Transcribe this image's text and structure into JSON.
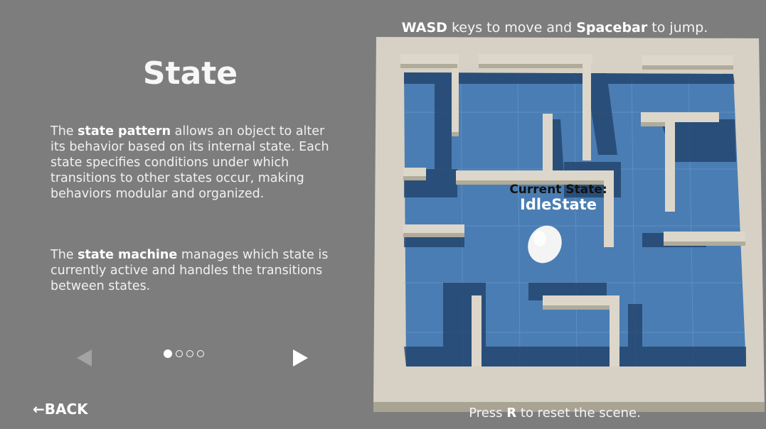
{
  "left_panel": {
    "title": "State",
    "para1": {
      "t1": "The ",
      "b1": "state pattern",
      "t2": " allows an object to alter its behavior based on its internal state. Each state specifies conditions under which transitions to other states occur, making behaviors modular and organized."
    },
    "para2": {
      "t1": "The ",
      "b1": "state machine",
      "t2": " manages which state is currently active and handles the transitions between states."
    },
    "pagination": {
      "current": 1,
      "total": 4
    },
    "back_label": "←BACK"
  },
  "scene": {
    "hint_top": {
      "k1": "WASD",
      "t1": " keys to move and ",
      "k2": "Spacebar",
      "t2": " to jump."
    },
    "hint_bottom": {
      "t1": "Press ",
      "k1": "R",
      "t2": " to reset the scene."
    },
    "state_caption": "Current State:",
    "state_value": "IdleState"
  },
  "colors": {
    "background": "#7d7d7d",
    "floor": "#4a7db3",
    "wall_top": "#d8d3c6",
    "wall_side": "#b4ad9c"
  }
}
